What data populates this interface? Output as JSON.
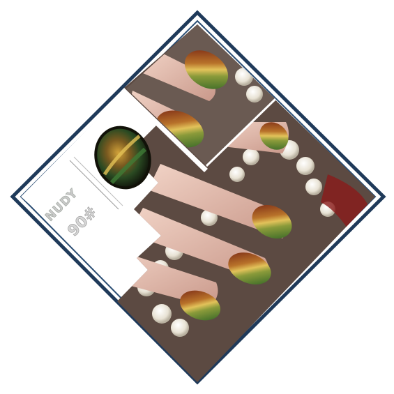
{
  "product": {
    "brand": "NUDY",
    "shade_code": "90#"
  },
  "colors": {
    "frame_outer": "#1f3a5a",
    "frame_inner": "#2b4e74",
    "card_bg": "#ffffff",
    "skin": "#e9c7b8",
    "skin_shadow": "#c99a88",
    "nail_green": "#2f6b2a",
    "nail_gold": "#d8b445",
    "nail_red": "#7a1f12",
    "pearl": "#f3efe6",
    "backdrop": "#5c4a42"
  },
  "icons": [
    "nail-polish-swatch-icon"
  ]
}
